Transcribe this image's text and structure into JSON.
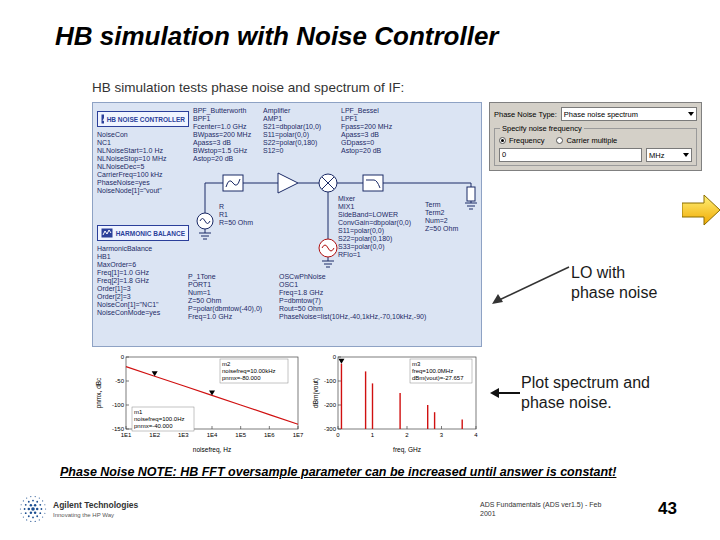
{
  "slide": {
    "title": "HB simulation with Noise Controller",
    "subtitle": "HB simulation tests phase noise and spectrum of IF:",
    "note": "Phase Noise NOTE:  HB FFT oversample parameter can be increased until answer is constant!",
    "page": "43"
  },
  "schematic": {
    "parts": [
      {
        "kind": "controller",
        "title": "HB NOISE CONTROLLER",
        "lines": [
          "NoiseCon",
          "NC1",
          "NLNoiseStart=1.0 Hz",
          "NLNoiseStop=10 MHz",
          "NLNoiseDec=5",
          "CarrierFreq=100 kHz",
          "PhaseNoise=yes",
          "NoiseNode[1]=\"vout\""
        ]
      },
      {
        "kind": "controller",
        "title": "HARMONIC BALANCE",
        "lines": [
          "HarmonicBalance",
          "HB1",
          "MaxOrder=6",
          "Freq[1]=1.0 GHz",
          "Freq[2]=1.8 GHz",
          "Order[1]=3",
          "Order[2]=3",
          "NoiseCon[1]=\"NC1\"",
          "NoiseConMode=yes"
        ]
      },
      {
        "kind": "component",
        "title": "",
        "lines": [
          "BPF_Butterworth",
          "BPF1",
          "Fcenter=1.0 GHz",
          "BWpass=200 MHz",
          "Apass=3 dB",
          "BWstop=1.5 GHz",
          "Astop=20 dB"
        ]
      },
      {
        "kind": "component",
        "title": "",
        "lines": [
          "Amplifier",
          "AMP1",
          "S21=dbpolar(10,0)",
          "S11=polar(0,0)",
          "S22=polar(0,180)",
          "S12=0"
        ]
      },
      {
        "kind": "component",
        "title": "",
        "lines": [
          "LPF_Bessel",
          "LPF1",
          "Fpass=200 MHz",
          "Apass=3 dB",
          "GDpass=0",
          "Astop=20 dB"
        ]
      },
      {
        "kind": "component",
        "title": "",
        "lines": [
          "Term",
          "Term2",
          "Num=2",
          "Z=50 Ohm"
        ]
      },
      {
        "kind": "component",
        "title": "",
        "lines": [
          "Mixer",
          "MIX1",
          "SideBand=LOWER",
          "ConvGain=dbpolar(0,0)",
          "S11=polar(0,0)",
          "S22=polar(0,180)",
          "S33=polar(0,0)",
          "RFlo=1"
        ]
      },
      {
        "kind": "component",
        "title": "",
        "lines": [
          "R",
          "R1",
          "R=50 Ohm"
        ]
      },
      {
        "kind": "component",
        "title": "",
        "lines": [
          "P_1Tone",
          "PORT1",
          "Num=1",
          "Z=50 Ohm",
          "P=polar(dbmtow(-40),0)",
          "Freq=1.0 GHz"
        ]
      },
      {
        "kind": "component",
        "title": "",
        "lines": [
          "OSCwPhNoise",
          "OSC1",
          "Freq=1.8 GHz",
          "P=dbmtow(7)",
          "Rout=50 Ohm",
          "PhaseNoise=list(10Hz,-40,1kHz,-70,10kHz,-90)"
        ]
      }
    ]
  },
  "dialog": {
    "type_label": "Phase Noise Type:",
    "type_value": "Phase noise spectrum",
    "group_label": "Specify noise frequency",
    "options": [
      {
        "label": "Frequency",
        "selected": true
      },
      {
        "label": "Carrier multiple",
        "selected": false
      }
    ],
    "value": "0",
    "unit": "MHz"
  },
  "callouts": [
    {
      "text": "LO with phase noise"
    },
    {
      "text": "Plot spectrum and phase noise."
    }
  ],
  "charts": {
    "phase_noise": {
      "y_label": "pnmx, dBc",
      "x_label": "noisefreq, Hz",
      "x_ticks": [
        "1E1",
        "1E2",
        "1E3",
        "1E4",
        "1E5",
        "1E6",
        "1E7"
      ],
      "y_ticks": [
        "0",
        "-50",
        "-100",
        "-150"
      ],
      "values": [
        -20,
        -40,
        -60,
        -80,
        -100,
        -120,
        -140
      ],
      "markers": [
        {
          "point": 1,
          "lines": [
            "m1",
            "noisefreq=100.0Hz",
            "pnmx=-40.000"
          ]
        },
        {
          "point": 3,
          "lines": [
            "m2",
            "noisefreq=10.00kHz",
            "pnmx=-80.000"
          ]
        }
      ]
    },
    "spectrum": {
      "y_label": "dBm(vout)",
      "x_label": "freq, GHz",
      "x_ticks": [
        "0",
        "1",
        "2",
        "3",
        "4"
      ],
      "y_ticks": [
        "0",
        "-100",
        "-200",
        "-300"
      ],
      "freqs": [
        0.1,
        0.8,
        1.0,
        1.8,
        2.6,
        2.8,
        3.6
      ],
      "values": [
        -27.657,
        -60,
        -110,
        -150,
        -200,
        -230,
        -260
      ],
      "markers": [
        {
          "point": 0,
          "lines": [
            "m3",
            "freq=100.0MHz",
            "dBm(vout)=-27.657"
          ]
        }
      ]
    }
  },
  "footer": {
    "company": "Agilent Technologies",
    "tagline": "Innovating the HP Way",
    "course": "ADS Fundamentals (ADS ver1.5) - Feb",
    "year": "2001"
  }
}
